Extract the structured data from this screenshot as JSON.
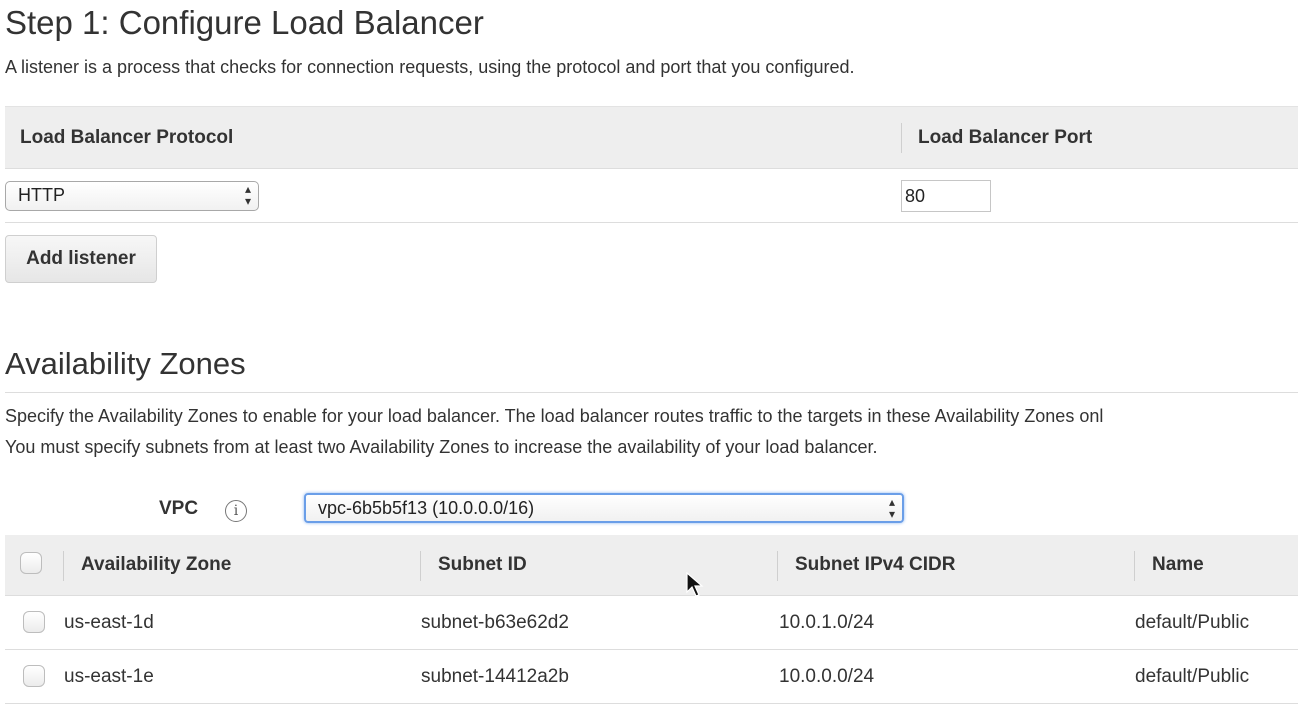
{
  "page": {
    "title": "Step 1: Configure Load Balancer",
    "description": "A listener is a process that checks for connection requests, using the protocol and port that you configured."
  },
  "listeners": {
    "columns": [
      "Load Balancer Protocol",
      "Load Balancer Port"
    ],
    "rows": [
      {
        "protocol": "HTTP",
        "port": "80"
      }
    ],
    "add_button": "Add listener"
  },
  "availability_zones": {
    "heading": "Availability Zones",
    "description_line1": "Specify the Availability Zones to enable for your load balancer. The load balancer routes traffic to the targets in these Availability Zones onl",
    "description_line2": "You must specify subnets from at least two Availability Zones to increase the availability of your load balancer.",
    "vpc_label": "VPC",
    "info_icon": "info-icon",
    "vpc_value": "vpc-6b5b5f13 (10.0.0.0/16)",
    "columns": [
      "Availability Zone",
      "Subnet ID",
      "Subnet IPv4 CIDR",
      "Name"
    ],
    "rows": [
      {
        "zone": "us-east-1d",
        "subnet_id": "subnet-b63e62d2",
        "cidr": "10.0.1.0/24",
        "name": "default/Public"
      },
      {
        "zone": "us-east-1e",
        "subnet_id": "subnet-14412a2b",
        "cidr": "10.0.0.0/24",
        "name": "default/Public"
      }
    ]
  },
  "colors": {
    "header_bg": "#eeeeee",
    "focus_ring": "#6a9ee8",
    "text": "#333333"
  }
}
